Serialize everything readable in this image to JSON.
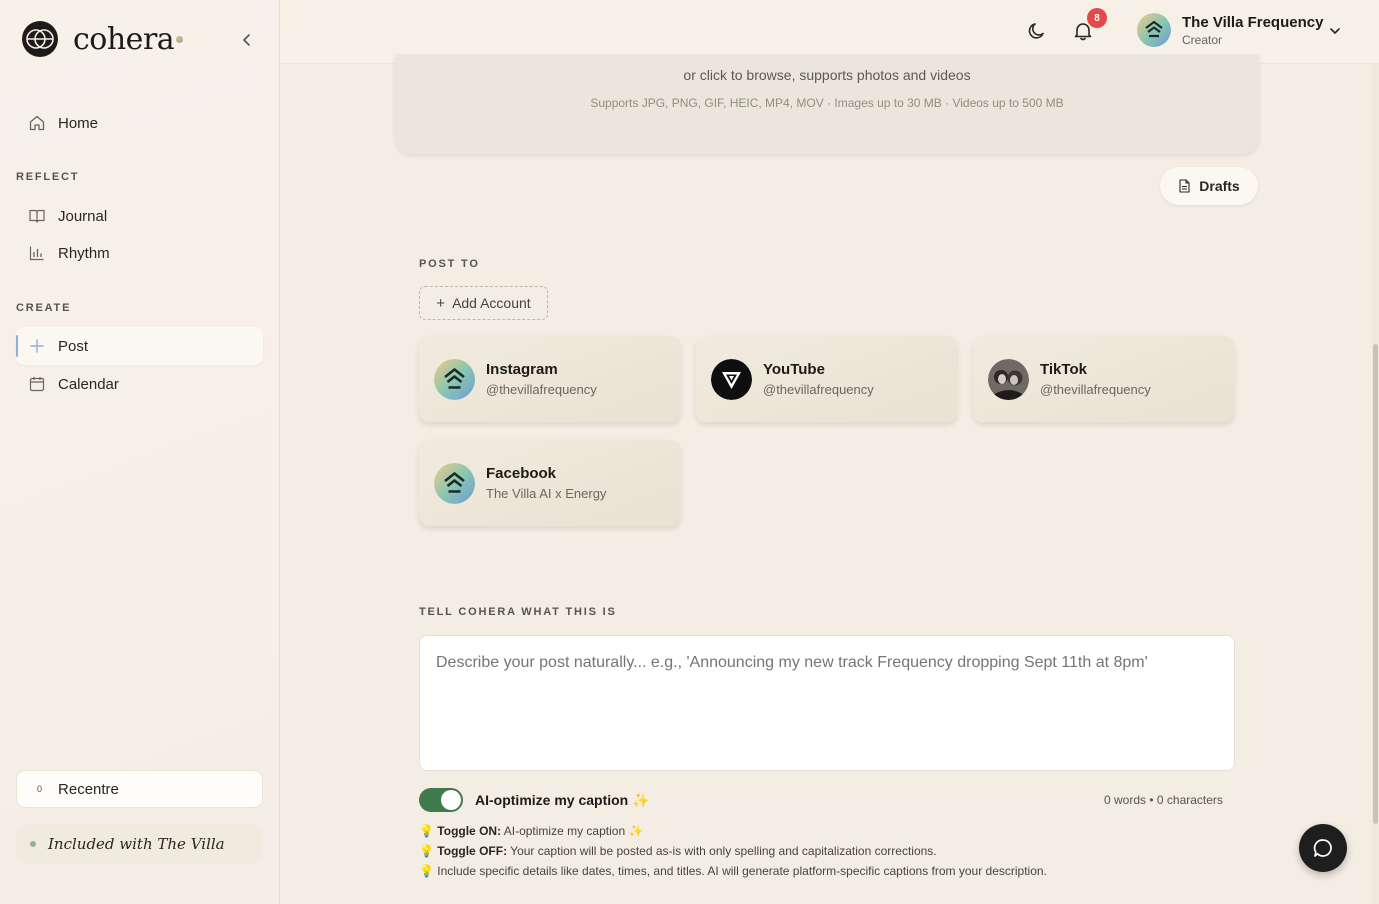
{
  "brand": {
    "name": "cohera"
  },
  "sidebar": {
    "home": "Home",
    "sections": [
      {
        "label": "REFLECT",
        "items": [
          "Journal",
          "Rhythm"
        ]
      },
      {
        "label": "CREATE",
        "items": [
          "Post",
          "Calendar"
        ]
      }
    ],
    "recentre": {
      "count": "0",
      "label": "Recentre"
    },
    "included": "Included with The Villa"
  },
  "header": {
    "notifications_count": "8",
    "profile": {
      "name": "The Villa Frequency",
      "role": "Creator"
    }
  },
  "upload": {
    "main_text": "or click to browse, supports photos and videos",
    "sub_text": "Supports JPG, PNG, GIF, HEIC, MP4, MOV · Images up to 30 MB · Videos up to 500 MB"
  },
  "drafts_label": "Drafts",
  "post_to": {
    "label": "POST TO",
    "add_account": "Add Account",
    "accounts": [
      {
        "platform": "Instagram",
        "handle": "@thevillafrequency",
        "icon": "villa-logo"
      },
      {
        "platform": "YouTube",
        "handle": "@thevillafrequency",
        "icon": "youtube-logo"
      },
      {
        "platform": "TikTok",
        "handle": "@thevillafrequency",
        "icon": "tiktok-photo"
      },
      {
        "platform": "Facebook",
        "handle": "The Villa AI x Energy",
        "icon": "villa-logo"
      }
    ]
  },
  "describe": {
    "label": "TELL COHERA WHAT THIS IS",
    "placeholder": "Describe your post naturally... e.g., 'Announcing my new track Frequency dropping Sept 11th at 8pm'",
    "value": ""
  },
  "ai_toggle": {
    "label": "AI-optimize my caption ✨",
    "on": true,
    "count_text": "0 words • 0 characters"
  },
  "tips": [
    {
      "emoji": "💡",
      "bold": "Toggle ON:",
      "text": " AI-optimize my caption ✨"
    },
    {
      "emoji": "💡",
      "bold": "Toggle OFF:",
      "text": " Your caption will be posted as-is with only spelling and capitalization corrections."
    },
    {
      "emoji": "💡",
      "bold": "",
      "text": "Include specific details like dates, times, and titles. AI will generate platform-specific captions from your description."
    }
  ],
  "colors": {
    "accent_green": "#3f7a4d",
    "badge_red": "#e5484d",
    "active_indicator": "#8fb0d2"
  }
}
